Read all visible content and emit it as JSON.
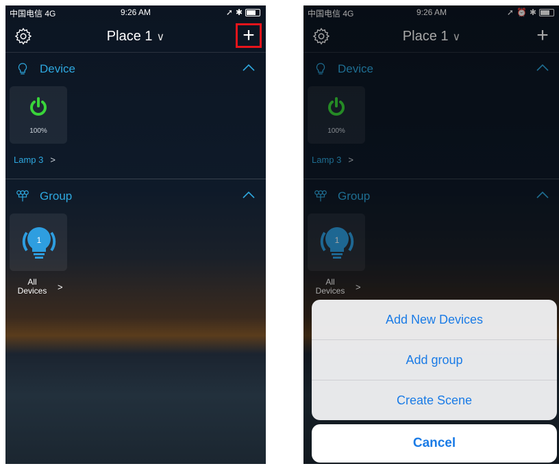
{
  "status": {
    "carrier": "中国电信 4G",
    "time": "9:26 AM"
  },
  "nav": {
    "title": "Place 1",
    "add_symbol": "+"
  },
  "device_section": {
    "label": "Device",
    "tile_percent": "100%",
    "device_name": "Lamp 3",
    "arrow": ">"
  },
  "group_section": {
    "label": "Group",
    "group_count": "1",
    "group_name_line1": "All",
    "group_name_line2": "Devices",
    "arrow": ">"
  },
  "action_sheet": {
    "items": [
      "Add New Devices",
      "Add group",
      "Create Scene"
    ],
    "cancel": "Cancel"
  },
  "colors": {
    "accent": "#2ea8df",
    "power_green": "#39d43a",
    "highlight": "#e8141b",
    "action_blue": "#1a7be6"
  }
}
